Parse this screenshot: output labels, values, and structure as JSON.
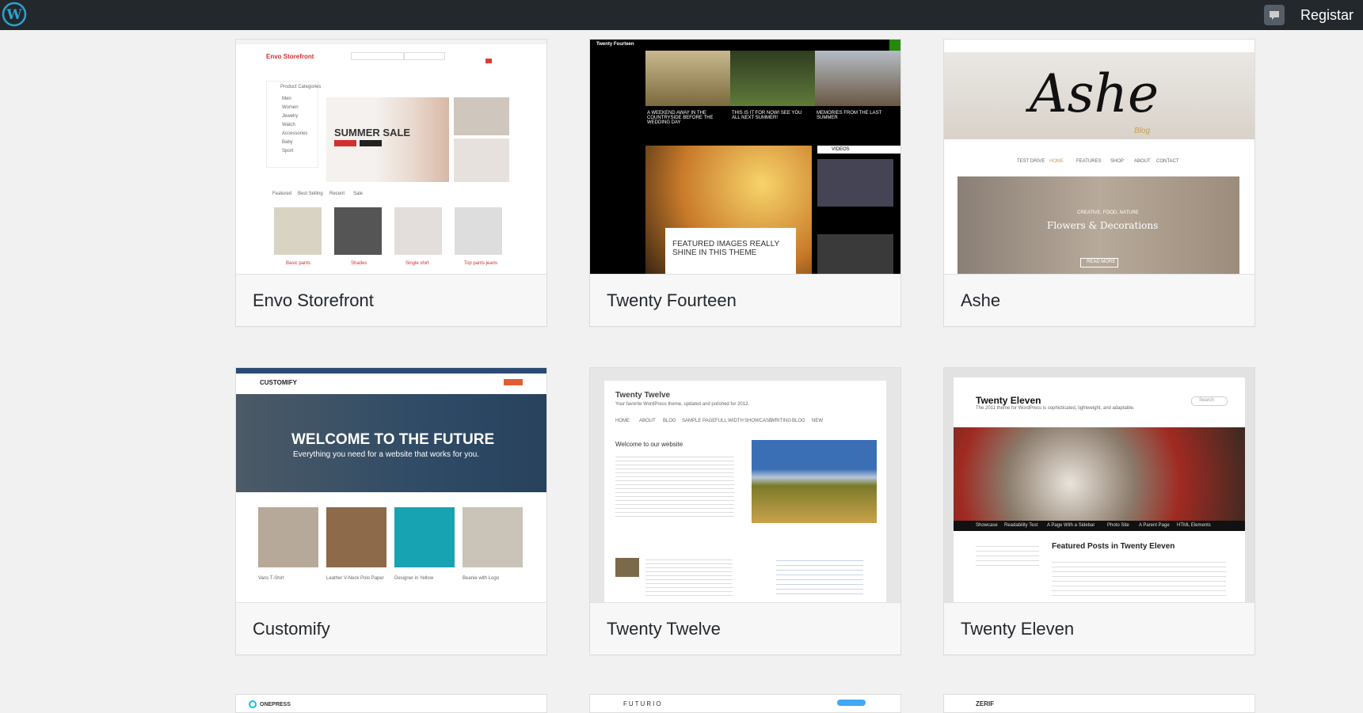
{
  "adminbar": {
    "logo_icon": "wordpress-logo-icon",
    "notifications_icon": "comment-bubble-icon",
    "register_label": "Registar"
  },
  "themes": [
    {
      "name": "Envo Storefront"
    },
    {
      "name": "Twenty Fourteen"
    },
    {
      "name": "Ashe"
    },
    {
      "name": "Customify"
    },
    {
      "name": "Twenty Twelve"
    },
    {
      "name": "Twenty Eleven"
    }
  ],
  "previews": {
    "envo": {
      "site_title": "Envo Storefront",
      "banner_title": "SUMMER SALE",
      "category_header": "Product Categories",
      "categories": [
        "Men",
        "Women",
        "Jewelry",
        "Watch",
        "Accessories",
        "Baby",
        "Sport"
      ],
      "tabs": [
        "Featured",
        "Best Selling",
        "Recent",
        "Sale"
      ],
      "products": [
        "Basic pants",
        "Shades",
        "Single shirt",
        "Top pants jeans"
      ]
    },
    "fourteen": {
      "site_title": "Twenty Fourteen",
      "post1": "A WEEKEND AWAY IN THE COUNTRYSIDE BEFORE THE WEDDING DAY",
      "post2": "THIS IS IT FOR NOW! SEE YOU ALL NEXT SUMMER!",
      "post3": "MEMORIES FROM THE LAST SUMMER",
      "featured": "FEATURED IMAGES REALLY SHINE IN THIS THEME",
      "videos_label": "VIDEOS"
    },
    "ashe": {
      "logo": "Ashe",
      "logo_sub": "Blog",
      "menu": [
        "TEST DRIVE",
        "HOME",
        "FEATURES",
        "SHOP",
        "ABOUT",
        "CONTACT"
      ],
      "slide_kicker": "CREATIVE, FOOD, NATURE",
      "slide_title": "Flowers & Decorations",
      "slide_button": "READ MORE"
    },
    "customify": {
      "logo": "CUSTOMIFY",
      "hero_title": "WELCOME TO THE FUTURE",
      "hero_sub": "Everything you need for a website that works for you.",
      "products": [
        "Vans T-Shirt",
        "Leather V-Neck Polo Paper",
        "Designer in Yellow",
        "Beanie with Logo"
      ]
    },
    "twelve": {
      "site_title": "Twenty Twelve",
      "tagline": "Your favorite WordPress theme, updated and polished for 2012.",
      "welcome": "Welcome to our website",
      "nav": [
        "HOME",
        "ABOUT",
        "BLOG",
        "SAMPLE PAGE",
        "FULL WIDTH",
        "SHOWCASE",
        "WRITING",
        "BLOG",
        "NEW"
      ]
    },
    "eleven": {
      "site_title": "Twenty Eleven",
      "tagline": "The 2011 theme for WordPress is sophisticated, lightweight, and adaptable.",
      "search_placeholder": "Search",
      "nav": [
        "Showcase",
        "Readability Test",
        "A Page With a Sidebar",
        "Photo Site",
        "A Parent Page",
        "HTML Elements"
      ],
      "featured_title": "Featured Posts in Twenty Eleven"
    },
    "bottom": {
      "onepress": "ONEPRESS",
      "futurio": "FUTURIO",
      "zerif": "ZERIF"
    }
  }
}
